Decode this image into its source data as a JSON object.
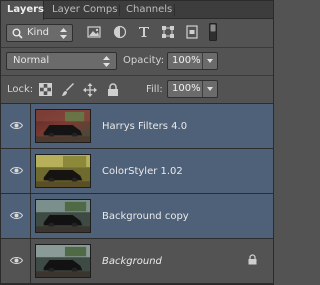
{
  "tabs": [
    {
      "label": "Layers",
      "active": true
    },
    {
      "label": "Layer Comps",
      "active": false
    },
    {
      "label": "Channels",
      "active": false
    }
  ],
  "filter": {
    "kind_label": "Kind",
    "icons": [
      "image-filter-icon",
      "adjustment-filter-icon",
      "type-filter-icon",
      "shape-filter-icon",
      "smart-object-filter-icon",
      "filter-toggle-icon"
    ]
  },
  "blend": {
    "mode": "Normal",
    "opacity_label": "Opacity:",
    "opacity_value": "100%"
  },
  "lock": {
    "label": "Lock:",
    "icons": [
      "lock-transparent-pixels-icon",
      "lock-image-pixels-icon",
      "lock-position-icon",
      "lock-all-icon"
    ],
    "fill_label": "Fill:",
    "fill_value": "100%"
  },
  "layers": [
    {
      "name": "Harrys Filters 4.0",
      "selected": true,
      "italic": false,
      "locked": false,
      "thumb": "harrys"
    },
    {
      "name": "ColorStyler 1.02",
      "selected": true,
      "italic": false,
      "locked": false,
      "thumb": "colorstyler"
    },
    {
      "name": "Background copy",
      "selected": true,
      "italic": false,
      "locked": false,
      "thumb": "bgcopy"
    },
    {
      "name": "Background",
      "selected": false,
      "italic": true,
      "locked": true,
      "thumb": "bg"
    }
  ],
  "colors": {
    "panel_bg": "#535353",
    "selected_row": "#4f6178",
    "field_bg": "#6b6b6b"
  }
}
